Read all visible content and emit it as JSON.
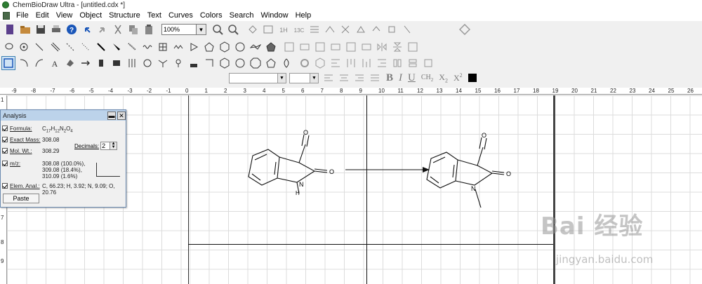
{
  "window": {
    "title": "ChemBioDraw Ultra - [untitled.cdx *]"
  },
  "menu": [
    "File",
    "Edit",
    "View",
    "Object",
    "Structure",
    "Text",
    "Curves",
    "Colors",
    "Search",
    "Window",
    "Help"
  ],
  "toolbar": {
    "zoom_value": "100%"
  },
  "ruler": {
    "ticks": [
      "-9",
      "-8",
      "-7",
      "-6",
      "-5",
      "-4",
      "-3",
      "-2",
      "-1",
      "0",
      "1",
      "2",
      "3",
      "4",
      "5",
      "6",
      "7",
      "8",
      "9",
      "10",
      "11",
      "12",
      "13",
      "14",
      "15",
      "16",
      "17",
      "18",
      "19",
      "20",
      "21",
      "22",
      "23",
      "24",
      "25",
      "26"
    ],
    "vticks": [
      "1",
      "7",
      "8",
      "9"
    ]
  },
  "analysis": {
    "title": "Analysis",
    "formula_label": "Formula:",
    "formula_value": "C17H12N2O4",
    "exact_mass_label": "Exact Mass:",
    "exact_mass_value": "308.08",
    "mol_wt_label": "Mol. Wt.:",
    "mol_wt_value": "308.29",
    "mz_label": "m/z:",
    "mz_value": "308.08 (100.0%), 309.08 (18.4%), 310.09 (1.6%)",
    "elem_label": "Elem. Anal.:",
    "elem_value": "C, 66.23; H, 3.92; N, 9.09; O, 20.76",
    "decimals_label": "Decimals:",
    "decimals_value": "2",
    "paste_label": "Paste"
  },
  "molecules": {
    "left": {
      "o_top": "O",
      "o_right": "O",
      "n": "N",
      "h": "H"
    },
    "right": {
      "o_top": "O",
      "o_right": "O",
      "n": "N"
    }
  },
  "watermark": {
    "brand": "Bai 经验",
    "url": "jingyan.baidu.com"
  },
  "colors": {
    "accent": "#bcd3ea",
    "selection": "#cfe3f5"
  }
}
